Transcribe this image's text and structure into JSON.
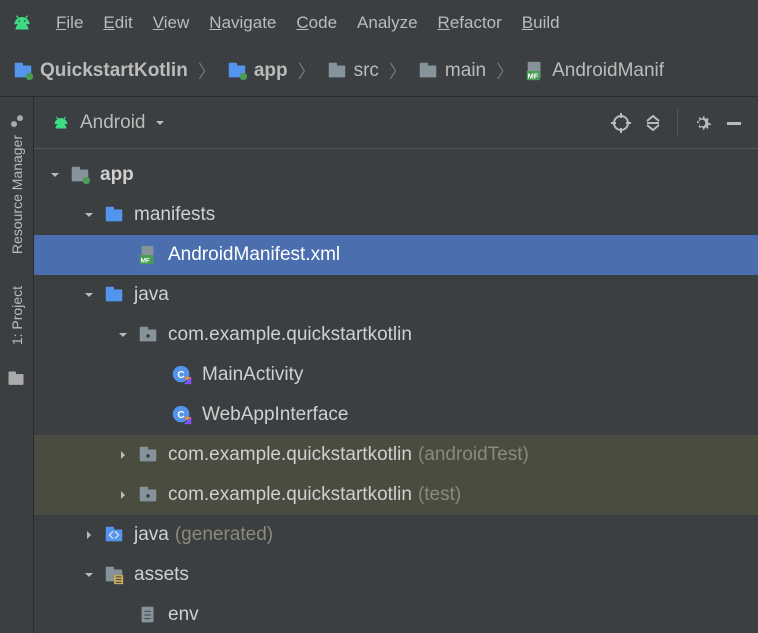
{
  "menu": {
    "items": [
      "File",
      "Edit",
      "View",
      "Navigate",
      "Code",
      "Analyze",
      "Refactor",
      "Build"
    ]
  },
  "breadcrumb": {
    "crumbs": [
      {
        "label": "QuickstartKotlin",
        "icon": "project",
        "bold": true
      },
      {
        "label": "app",
        "icon": "module",
        "bold": true
      },
      {
        "label": "src",
        "icon": "folder",
        "bold": false
      },
      {
        "label": "main",
        "icon": "folder",
        "bold": false
      },
      {
        "label": "AndroidManif",
        "icon": "manifest",
        "bold": false
      }
    ]
  },
  "tool_header": {
    "selector": "Android"
  },
  "sidebar": {
    "tabs": [
      {
        "label": "Resource Manager",
        "icon": "resource"
      },
      {
        "label": "1: Project",
        "icon": "project-file"
      }
    ]
  },
  "tree": {
    "nodes": [
      {
        "depth": 0,
        "arrow": "down",
        "icon": "module",
        "label": "app",
        "bold": true
      },
      {
        "depth": 1,
        "arrow": "down",
        "icon": "folder",
        "label": "manifests"
      },
      {
        "depth": 2,
        "arrow": "none",
        "icon": "manifest",
        "label": "AndroidManifest.xml",
        "selected": true
      },
      {
        "depth": 1,
        "arrow": "down",
        "icon": "folder",
        "label": "java"
      },
      {
        "depth": 2,
        "arrow": "down",
        "icon": "package",
        "label": "com.example.quickstartkotlin"
      },
      {
        "depth": 3,
        "arrow": "none",
        "icon": "kotlin-class",
        "label": "MainActivity"
      },
      {
        "depth": 3,
        "arrow": "none",
        "icon": "kotlin-class",
        "label": "WebAppInterface"
      },
      {
        "depth": 2,
        "arrow": "right",
        "icon": "package",
        "label": "com.example.quickstartkotlin",
        "suffix": "(androidTest)",
        "highlight": true
      },
      {
        "depth": 2,
        "arrow": "right",
        "icon": "package",
        "label": "com.example.quickstartkotlin",
        "suffix": "(test)",
        "highlight": true
      },
      {
        "depth": 1,
        "arrow": "right",
        "icon": "gen-folder",
        "label": "java",
        "suffix": "(generated)"
      },
      {
        "depth": 1,
        "arrow": "down",
        "icon": "assets-folder",
        "label": "assets"
      },
      {
        "depth": 2,
        "arrow": "none",
        "icon": "file",
        "label": "env"
      }
    ]
  }
}
